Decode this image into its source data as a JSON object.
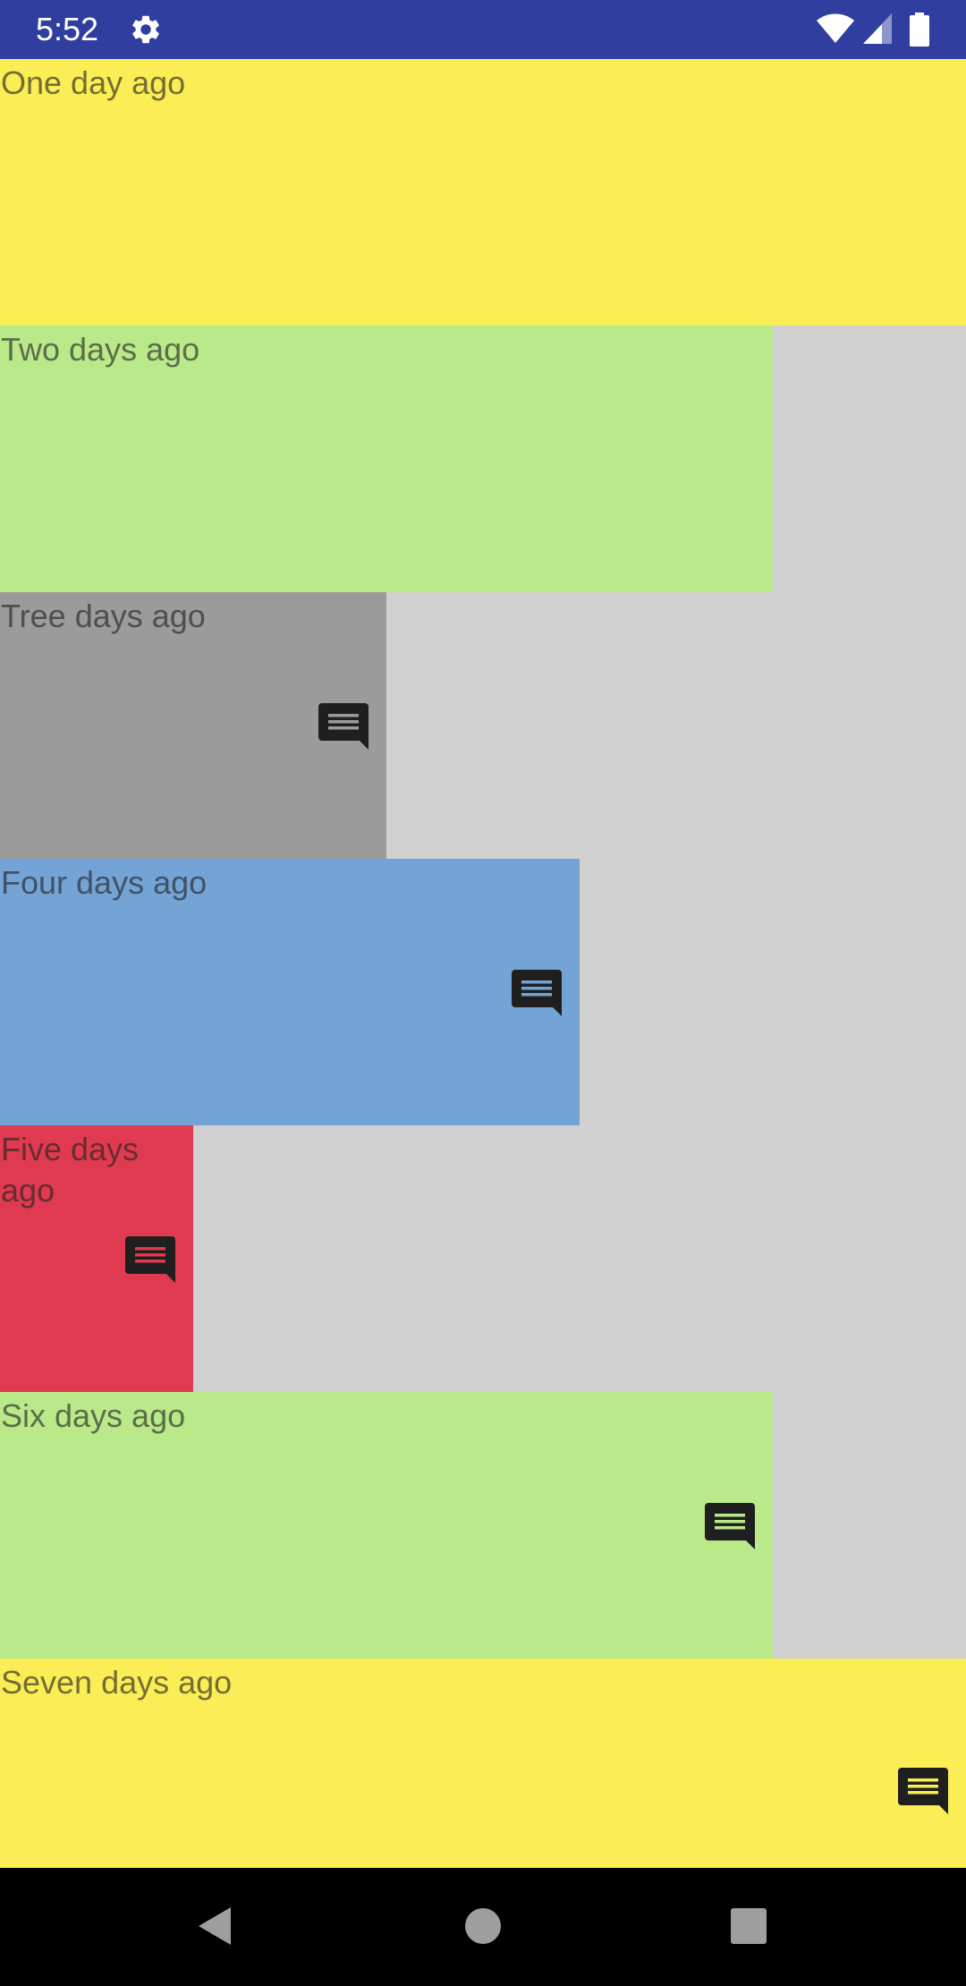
{
  "status_bar": {
    "time": "5:52",
    "background_color": "#303f9f",
    "icons": [
      "settings-gear-icon",
      "wifi-icon",
      "cell-signal-icon",
      "battery-icon"
    ]
  },
  "list": {
    "items": [
      {
        "label": "One day ago",
        "color": "#fbed55",
        "width_fraction": 1.0,
        "has_comment_icon": false
      },
      {
        "label": "Two days ago",
        "color": "#bae989",
        "width_fraction": 0.8,
        "has_comment_icon": false
      },
      {
        "label": "Tree days ago",
        "color": "#9b9b9b",
        "width_fraction": 0.4,
        "has_comment_icon": true
      },
      {
        "label": "Four days ago",
        "color": "#74a3d6",
        "width_fraction": 0.6,
        "has_comment_icon": true
      },
      {
        "label": "Five days ago",
        "color": "#df3a4f",
        "width_fraction": 0.2,
        "has_comment_icon": true
      },
      {
        "label": "Six days ago",
        "color": "#bae989",
        "width_fraction": 0.8,
        "has_comment_icon": true
      },
      {
        "label": "Seven days ago",
        "color": "#fbed55",
        "width_fraction": 1.0,
        "has_comment_icon": true
      }
    ],
    "background_color": "#cfd0cf"
  },
  "nav_bar": {
    "buttons": [
      "back-icon",
      "home-icon",
      "recents-icon"
    ],
    "background_color": "#000000"
  }
}
